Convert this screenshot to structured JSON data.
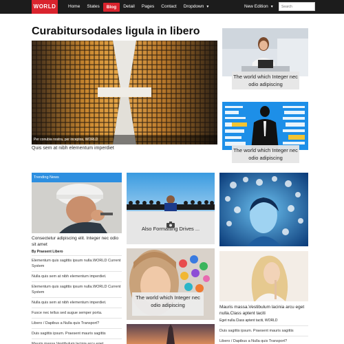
{
  "nav": {
    "logo": "WORLD",
    "items": [
      "Home",
      "States",
      "Blog",
      "Detail",
      "Pages",
      "Contact",
      "Dropdown"
    ],
    "active_index": 2,
    "edition": "New Edition",
    "search_placeholder": "Search"
  },
  "main": {
    "headline": "Curabitursodales ligula in libero",
    "hero_caption": "Per conubia nostra, per inceptos, WORLD",
    "hero_subtitle": "Quis sem at nibh elementum imperdiet"
  },
  "featured": [
    {
      "caption": "The world which Integer nec odio adipiscing"
    },
    {
      "caption": "The world which Integer nec odio adipiscing"
    }
  ],
  "trending": {
    "header": "Trending News",
    "title": "Consectetur adipiscing elit. Integer nec odio sit amet",
    "byline": "By Praesent Libero",
    "items": [
      "Elementum quis sagittis ipsum nulla.WORLD Current System",
      "Nulla quis sem at nibh elementum imperdiet.",
      "Elementum quis sagittis ipsum nulla.WORLD Current System",
      "Nulla quis sem at nibh elementum imperdiet.",
      "Fusce nec tellus sed augue semper porta.",
      "Libero / Dapibus a Nulla quis Transport?",
      "Duis sagittis ipsum. Praesent mauris sagittis",
      "Mauris massa.Vestibulum lacinia arcu eget nulla.Class aptent taciti"
    ]
  },
  "tiles": {
    "drives_caption": "Also Formatting Drives ...",
    "girl_caption": "The world which Integer nec odio adipiscing"
  },
  "right_column": {
    "title": "Mauris massa.Vestibulum lacinia arcu eget nulla.Class aptent taciti",
    "byline": "Eget nulla.Class aptent taciti, WORLD",
    "items": [
      "Duis sagittis ipsum. Praesent mauris sagittis",
      "Libero / Dapibus a Nulla quis Transport?"
    ]
  },
  "colors": {
    "accent": "#d9232d",
    "topbar": "#1c1c1c",
    "trending": "#2d8fe0"
  }
}
